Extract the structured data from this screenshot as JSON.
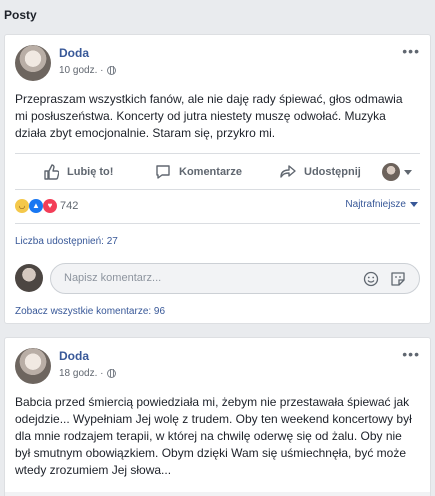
{
  "section": {
    "title": "Posty"
  },
  "posts": [
    {
      "author": "Doda",
      "time": "10 godz. ·",
      "text": "Przepraszam wszystkich fanów, ale nie daję rady śpiewać, głos odmawia mi posłuszeństwa. Koncerty od jutra niestety muszę odwołać. Muzyka działa zbyt emocjonalnie. Staram się, przykro mi.",
      "actions": {
        "like": "Lubię to!",
        "comment": "Komentarze",
        "share": "Udostępnij"
      },
      "reactions": {
        "count": "742",
        "sort_label": "Najtrafniejsze"
      },
      "shares": "Liczba udostępnień: 27",
      "comment_placeholder": "Napisz komentarz...",
      "all_comments": "Zobacz wszystkie komentarze: 96"
    },
    {
      "author": "Doda",
      "time": "18 godz. ·",
      "text": "Babcia przed śmiercią powiedziała mi, żebym nie przestawała śpiewać jak odejdzie... Wypełniam Jej wolę z trudem. Oby ten weekend koncertowy był dla mnie rodzajem terapii, w której na chwilę oderwę się od żalu. Oby nie był smutnym obowiązkiem. Obym dzięki Wam się uśmiechnęła, być może wtedy zrozumiem Jej słowa..."
    }
  ],
  "colors": {
    "link": "#385898",
    "secondary": "#606770",
    "border": "#dddfe2"
  },
  "icons": [
    "globe-icon",
    "more-icon",
    "like-icon",
    "comment-icon",
    "share-icon",
    "caret-down-icon",
    "sad-reaction-icon",
    "like-reaction-icon",
    "love-reaction-icon",
    "emoji-icon",
    "sticker-icon"
  ]
}
